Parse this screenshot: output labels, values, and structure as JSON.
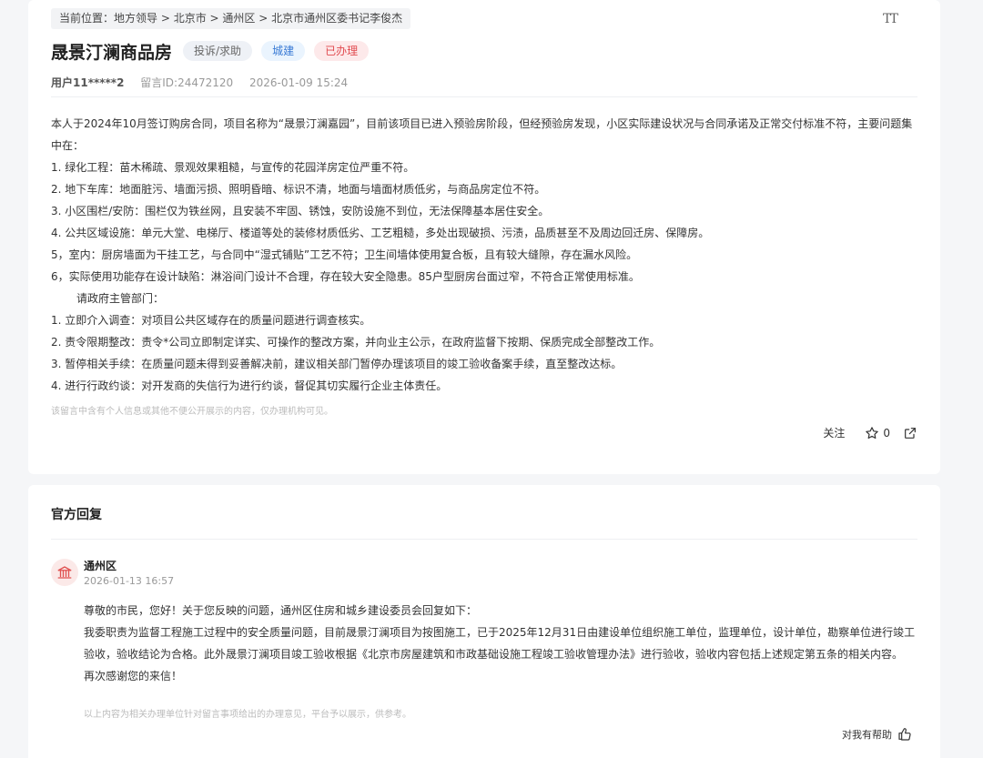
{
  "breadcrumb": {
    "prefix": "当前位置：",
    "items": [
      "地方领导",
      "北京市",
      "通州区",
      "北京市通州区委书记李俊杰"
    ],
    "separator": " > "
  },
  "font_size_icon_label": "TT",
  "message": {
    "title": "晟景汀澜商品房",
    "tags": {
      "type": "投诉/求助",
      "dept": "城建",
      "status": "已办理"
    },
    "user": "用户11*****2",
    "id_label": "留言ID:24472120",
    "datetime": "2026-01-09 15:24",
    "paragraphs": [
      "本人于2024年10月签订购房合同，项目名称为“晟景汀澜嘉园”，目前该项目已进入预验房阶段，但经预验房发现，小区实际建设状况与合同承诺及正常交付标准不符，主要问题集中在：",
      "1. 绿化工程：苗木稀疏、景观效果粗糙，与宣传的花园洋房定位严重不符。",
      "2. 地下车库：地面脏污、墙面污损、照明昏暗、标识不清，地面与墙面材质低劣，与商品房定位不符。",
      "3. 小区围栏/安防：围栏仅为铁丝网，且安装不牢固、锈蚀，安防设施不到位，无法保障基本居住安全。",
      "4. 公共区域设施：单元大堂、电梯厅、楼道等处的装修材质低劣、工艺粗糙，多处出现破损、污渍，品质甚至不及周边回迁房、保障房。",
      "5，室内：厨房墙面为干挂工艺，与合同中“湿式铺贴”工艺不符；卫生间墙体使用复合板，且有较大缝隙，存在漏水风险。",
      "6，实际使用功能存在设计缺陷：淋浴间门设计不合理，存在较大安全隐患。85户型厨房台面过窄，不符合正常使用标准。",
      "请政府主管部门：",
      "1. 立即介入调查：对项目公共区域存在的质量问题进行调查核实。",
      "2. 责令限期整改：责令*公司立即制定详实、可操作的整改方案，并向业主公示，在政府监督下按期、保质完成全部整改工作。",
      "3. 暂停相关手续：在质量问题未得到妥善解决前，建议相关部门暂停办理该项目的竣工验收备案手续，直至整改达标。",
      "4. 进行行政约谈：对开发商的失信行为进行约谈，督促其切实履行企业主体责任。"
    ],
    "privacy_notice": "该留言中含有个人信息或其他不便公开展示的内容，仅办理机构可见。",
    "follow_label": "关注",
    "star_count": "0"
  },
  "reply": {
    "section_title": "官方回复",
    "name": "通州区",
    "time": "2026-01-13 16:57",
    "paragraphs": [
      "尊敬的市民，您好！关于您反映的问题，通州区住房和城乡建设委员会回复如下：",
      "我委职责为监督工程施工过程中的安全质量问题，目前晟景汀澜项目为按图施工，已于2025年12月31日由建设单位组织施工单位，监理单位，设计单位，勘察单位进行竣工验收，验收结论为合格。此外晟景汀澜项目竣工验收根据《北京市房屋建筑和市政基础设施工程竣工验收管理办法》进行验收，验收内容包括上述规定第五条的相关内容。",
      "再次感谢您的来信！"
    ],
    "notice": "以上内容为相关办理单位针对留言事项给出的办理意见，平台予以展示，供参考。",
    "helpful_label": "对我有帮助"
  },
  "icons": {
    "font_size": "font-size-icon",
    "star": "star-icon",
    "share": "share-icon",
    "gov_building": "government-building-icon",
    "thumbs_up": "thumbs-up-icon"
  },
  "colors": {
    "tag_dept": "#3a7bd5",
    "tag_status": "#e14a4f",
    "avatar_icon": "#e0504f"
  }
}
